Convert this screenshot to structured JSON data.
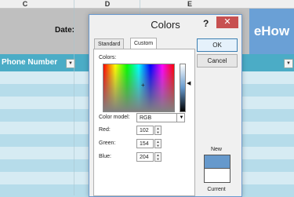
{
  "sheet": {
    "columns": [
      "C",
      "D",
      "E"
    ],
    "date_label": "Date:",
    "phone_header": "Phone Number",
    "logo_text": "eHow",
    "filter_glyph": "▼"
  },
  "dialog": {
    "title": "Colors",
    "help": "?",
    "close": "✕",
    "tabs": [
      "Standard",
      "Custom"
    ],
    "active_tab": "Custom",
    "colors_label": "Colors:",
    "crosshair": "+",
    "luminance_arrow": "◀",
    "color_model_label": "Color model:",
    "color_model_value": "RGB",
    "select_arrow": "▼",
    "fields": [
      {
        "label": "Red:",
        "value": "102"
      },
      {
        "label": "Green:",
        "value": "154"
      },
      {
        "label": "Blue:",
        "value": "204"
      }
    ],
    "spin_up": "▲",
    "spin_down": "▼",
    "ok_label": "OK",
    "cancel_label": "Cancel",
    "new_label": "New",
    "current_label": "Current",
    "new_color": "#6699cc",
    "current_color": "#ffffff"
  }
}
